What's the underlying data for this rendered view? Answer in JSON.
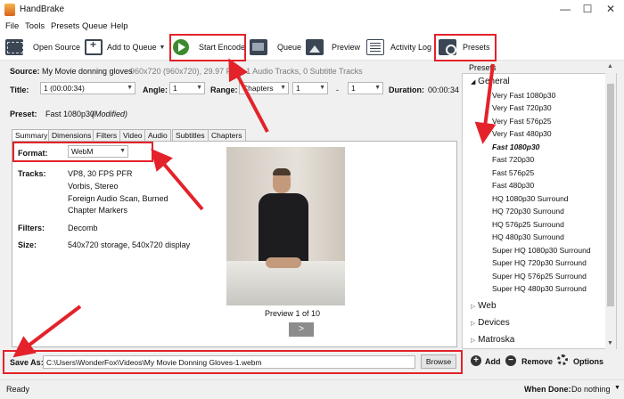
{
  "window": {
    "title": "HandBrake"
  },
  "menu": [
    "File",
    "Tools",
    "Presets",
    "Queue",
    "Help"
  ],
  "toolbar": {
    "open_source": "Open Source",
    "add_to_queue": "Add to Queue",
    "start_encode": "Start Encode",
    "queue": "Queue",
    "preview": "Preview",
    "activity_log": "Activity Log",
    "presets": "Presets"
  },
  "source": {
    "label": "Source:",
    "value": "My Movie donning gloves",
    "info": "960x720 (960x720), 29.97 FPS, 1 Audio Tracks, 0 Subtitle Tracks"
  },
  "title_row": {
    "title_label": "Title:",
    "title_value": "1 (00:00:34)",
    "angle_label": "Angle:",
    "angle_value": "1",
    "range_label": "Range:",
    "range_value": "Chapters",
    "range_start": "1",
    "range_sep": "-",
    "range_end": "1",
    "duration_label": "Duration:",
    "duration_value": "00:00:34"
  },
  "preset_row": {
    "label": "Preset:",
    "value": "Fast 1080p30",
    "modified": "(Modified)"
  },
  "tabs": [
    "Summary",
    "Dimensions",
    "Filters",
    "Video",
    "Audio",
    "Subtitles",
    "Chapters"
  ],
  "summary": {
    "format_label": "Format:",
    "format_value": "WebM",
    "tracks_label": "Tracks:",
    "tracks": [
      "VP8, 30 FPS PFR",
      "Vorbis, Stereo",
      "Foreign Audio Scan, Burned",
      "Chapter Markers"
    ],
    "filters_label": "Filters:",
    "filters_value": "Decomb",
    "size_label": "Size:",
    "size_value": "540x720 storage, 540x720 display",
    "preview_caption": "Preview 1 of 10",
    "next_symbol": ">"
  },
  "save": {
    "label": "Save As:",
    "path": "C:\\Users\\WonderFox\\Videos\\My Movie Donning Gloves-1.webm",
    "browse": "Browse"
  },
  "presets_panel": {
    "header": "Presets",
    "general_label": "General",
    "general_items": [
      "Very Fast 1080p30",
      "Very Fast 720p30",
      "Very Fast 576p25",
      "Very Fast 480p30",
      "Fast 1080p30",
      "Fast 720p30",
      "Fast 576p25",
      "Fast 480p30",
      "HQ 1080p30 Surround",
      "HQ 720p30 Surround",
      "HQ 576p25 Surround",
      "HQ 480p30 Surround",
      "Super HQ 1080p30 Surround",
      "Super HQ 720p30 Surround",
      "Super HQ 576p25 Surround",
      "Super HQ 480p30 Surround"
    ],
    "selected_item": "Fast 1080p30",
    "groups": [
      "Web",
      "Devices",
      "Matroska"
    ],
    "add": "Add",
    "remove": "Remove",
    "options": "Options"
  },
  "status": {
    "left": "Ready",
    "when_done_label": "When Done:",
    "when_done_value": "Do nothing"
  },
  "colors": {
    "annotation_red": "#e3222a",
    "encode_green": "#3c8a2e"
  }
}
